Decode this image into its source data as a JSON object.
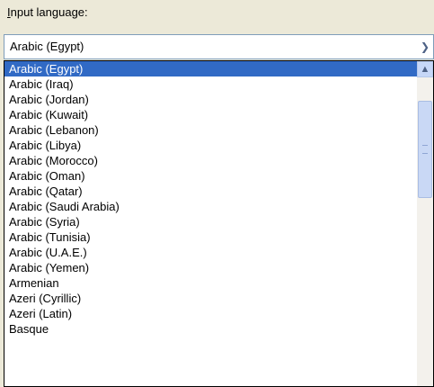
{
  "label": {
    "accel": "I",
    "rest": "nput language:"
  },
  "combo": {
    "value": "Arabic (Egypt)",
    "button_icon": "chevron-down-icon"
  },
  "list": {
    "items": [
      "Arabic (Egypt)",
      "Arabic (Iraq)",
      "Arabic (Jordan)",
      "Arabic (Kuwait)",
      "Arabic (Lebanon)",
      "Arabic (Libya)",
      "Arabic (Morocco)",
      "Arabic (Oman)",
      "Arabic (Qatar)",
      "Arabic (Saudi Arabia)",
      "Arabic (Syria)",
      "Arabic (Tunisia)",
      "Arabic (U.A.E.)",
      "Arabic (Yemen)",
      "Armenian",
      "Azeri (Cyrillic)",
      "Azeri (Latin)",
      "Basque"
    ],
    "selected_index": 0
  },
  "colors": {
    "selection": "#316ac5",
    "background": "#ece9d8"
  }
}
